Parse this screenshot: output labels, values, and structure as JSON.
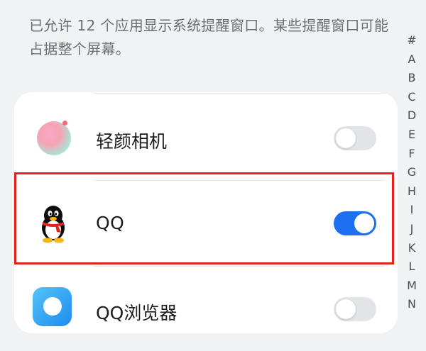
{
  "description": "已允许 12 个应用显示系统提醒窗口。某些提醒窗口可能占据整个屏幕。",
  "apps": [
    {
      "name": "轻颜相机",
      "enabled": false,
      "icon": "qingyan-camera-icon"
    },
    {
      "name": "QQ",
      "enabled": true,
      "icon": "qq-penguin-icon"
    },
    {
      "name": "QQ浏览器",
      "enabled": false,
      "icon": "qq-browser-icon"
    }
  ],
  "alphabet_index": [
    "#",
    "A",
    "B",
    "C",
    "D",
    "E",
    "F",
    "G",
    "H",
    "I",
    "J",
    "K",
    "L",
    "M",
    "N"
  ],
  "colors": {
    "toggle_on": "#1d6ef1",
    "toggle_off": "#e3e4e7",
    "highlight": "#e3221e"
  }
}
